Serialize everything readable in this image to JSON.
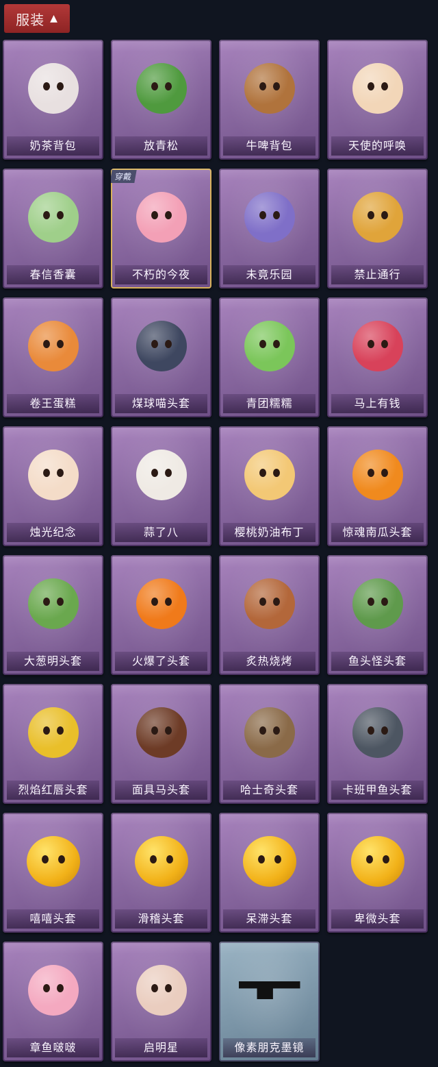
{
  "header": {
    "title": "服装",
    "expand_icon": "chevron-up-icon"
  },
  "items": [
    {
      "label": "奶茶背包",
      "icon": "milk-tea-bag-icon",
      "equipped": false
    },
    {
      "label": "放青松",
      "icon": "pine-bonsai-icon",
      "equipped": false
    },
    {
      "label": "牛啤背包",
      "icon": "cow-beer-barrel-icon",
      "equipped": false
    },
    {
      "label": "天使的呼唤",
      "icon": "angel-icon",
      "equipped": false
    },
    {
      "label": "春信香囊",
      "icon": "sachet-icon",
      "equipped": false
    },
    {
      "label": "不朽的今夜",
      "icon": "pink-fox-cup-icon",
      "equipped": true,
      "tag": "穿戴"
    },
    {
      "label": "未竟乐园",
      "icon": "doll-girl-icon",
      "equipped": false
    },
    {
      "label": "禁止通行",
      "icon": "no-entry-cone-icon",
      "equipped": false
    },
    {
      "label": "卷王蛋糕",
      "icon": "roll-cake-icon",
      "equipped": false
    },
    {
      "label": "煤球喵头套",
      "icon": "black-cat-head-icon",
      "equipped": false
    },
    {
      "label": "青团糯糯",
      "icon": "green-dumpling-icon",
      "equipped": false
    },
    {
      "label": "马上有钱",
      "icon": "red-horse-head-icon",
      "equipped": false
    },
    {
      "label": "烛光纪念",
      "icon": "candle-icon",
      "equipped": false
    },
    {
      "label": "蒜了八",
      "icon": "garlic-icon",
      "equipped": false
    },
    {
      "label": "樱桃奶油布丁",
      "icon": "pudding-icon",
      "equipped": false
    },
    {
      "label": "惊魂南瓜头套",
      "icon": "pumpkin-head-icon",
      "equipped": false
    },
    {
      "label": "大葱明头套",
      "icon": "scallion-head-icon",
      "equipped": false
    },
    {
      "label": "火爆了头套",
      "icon": "fire-head-icon",
      "equipped": false
    },
    {
      "label": "炙热烧烤",
      "icon": "meat-bone-icon",
      "equipped": false
    },
    {
      "label": "鱼头怪头套",
      "icon": "fish-head-icon",
      "equipped": false
    },
    {
      "label": "烈焰红唇头套",
      "icon": "yellow-pika-head-icon",
      "equipped": false
    },
    {
      "label": "面具马头套",
      "icon": "horse-mask-icon",
      "equipped": false
    },
    {
      "label": "哈士奇头套",
      "icon": "husky-head-icon",
      "equipped": false
    },
    {
      "label": "卡班甲鱼头套",
      "icon": "grey-fish-head-icon",
      "equipped": false
    },
    {
      "label": "嘻嘻头套",
      "icon": "grin-emoji-icon",
      "equipped": false
    },
    {
      "label": "滑稽头套",
      "icon": "smirk-emoji-icon",
      "equipped": false
    },
    {
      "label": "呆滞头套",
      "icon": "stare-emoji-icon",
      "equipped": false
    },
    {
      "label": "卑微头套",
      "icon": "timid-emoji-icon",
      "equipped": false
    },
    {
      "label": "章鱼啵啵",
      "icon": "pink-octopus-icon",
      "equipped": false
    },
    {
      "label": "启明星",
      "icon": "mannequin-icon",
      "equipped": false
    },
    {
      "label": "像素朋克墨镜",
      "icon": "pixel-sunglasses-icon",
      "equipped": false
    }
  ]
}
